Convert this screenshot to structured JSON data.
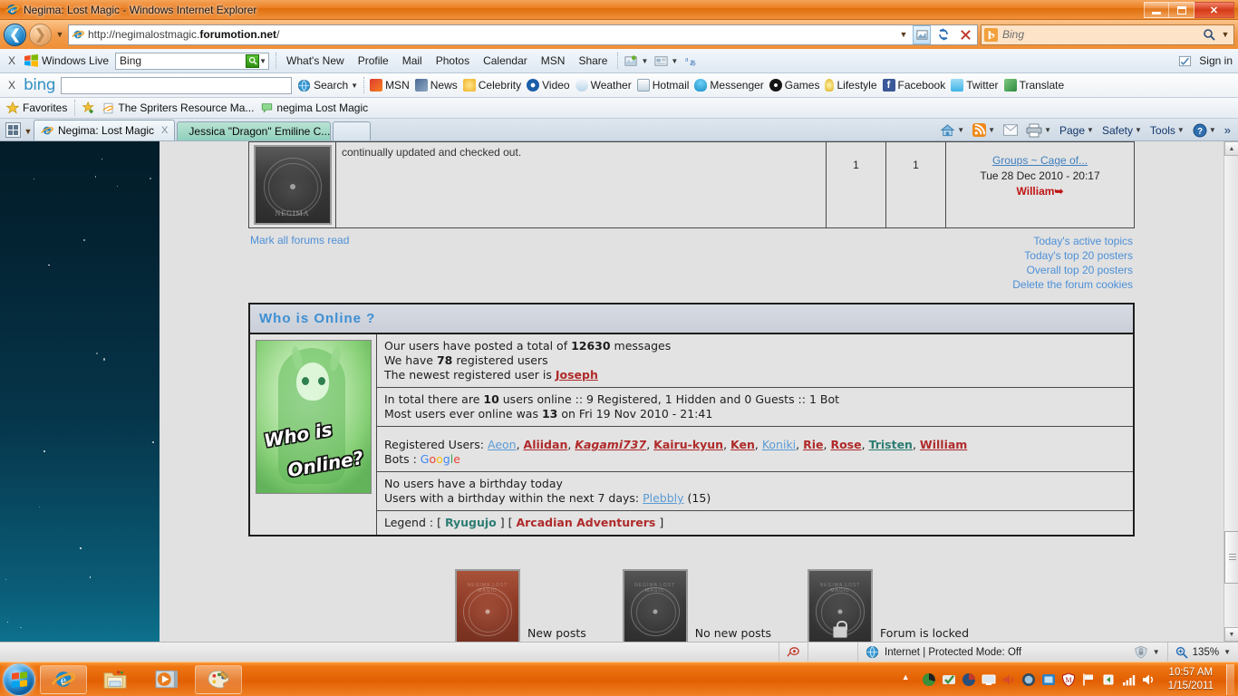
{
  "window": {
    "title": "Negima: Lost Magic - Windows Internet Explorer",
    "minimize_label": "Minimize",
    "maximize_label": "Restore",
    "close_label": "✕"
  },
  "address_bar": {
    "url_prefix": "http://negimalostmagic.",
    "url_bold": "forumotion.net",
    "url_suffix": "/",
    "search_placeholder": "Bing",
    "refresh_label": "↻",
    "stop_label": "✕"
  },
  "windows_live_bar": {
    "close_label": "X",
    "brand": "Windows Live",
    "search_value": "Bing",
    "links": [
      "What's New",
      "Profile",
      "Mail",
      "Photos",
      "Calendar",
      "MSN",
      "Share"
    ],
    "sign_in": "Sign in"
  },
  "bing_bar": {
    "close_label": "X",
    "brand": "bing",
    "search_value": "",
    "search_button": "Search",
    "links": [
      {
        "label": "MSN",
        "color": "#e03a2f"
      },
      {
        "label": "News",
        "color": "#3a5a8c"
      },
      {
        "label": "Celebrity",
        "color": "#f0c02a"
      },
      {
        "label": "Video",
        "color": "#1a5fa8"
      },
      {
        "label": "Weather",
        "color": "#8fbde0"
      },
      {
        "label": "Hotmail",
        "color": "#7c94a8"
      },
      {
        "label": "Messenger",
        "color": "#2aa5dd"
      },
      {
        "label": "Games",
        "color": "#1a1a1a"
      },
      {
        "label": "Lifestyle",
        "color": "#e8c53a"
      },
      {
        "label": "Facebook",
        "color": "#3b5998"
      },
      {
        "label": "Twitter",
        "color": "#3fb4e8"
      },
      {
        "label": "Translate",
        "color": "#3a9a4a"
      }
    ]
  },
  "favorites_bar": {
    "favorites_label": "Favorites",
    "items": [
      "The Spriters Resource  Ma...",
      "negima Lost Magic"
    ]
  },
  "tabs": {
    "active": "Negima: Lost Magic",
    "inactive": "Jessica \"Dragon\" Emiline C...",
    "close_label": "X",
    "commands": [
      "Page",
      "Safety",
      "Tools"
    ]
  },
  "forum_row": {
    "description": "continually updated and checked out.",
    "topics": "1",
    "posts": "1",
    "last_post_link": "Groups ~ Cage of...",
    "last_post_date": "Tue 28 Dec 2010 - 20:17",
    "last_post_author": "William",
    "card_label": "NEGIMA"
  },
  "forum_links": {
    "mark_read": "Mark all forums read",
    "right": [
      "Today's active topics",
      "Today's top 20 posters",
      "Overall top 20 posters",
      "Delete the forum cookies"
    ]
  },
  "who_is_online": {
    "heading": "Who is Online ?",
    "avatar_text_line1": "Who is",
    "avatar_text_line2": "Online?",
    "stats": {
      "posted_prefix": "Our users have posted a total of ",
      "total_messages": "12630",
      "posted_suffix": " messages",
      "registered_prefix": "We have ",
      "registered_count": "78",
      "registered_suffix": " registered users",
      "newest_prefix": "The newest registered user is ",
      "newest_user": "Joseph"
    },
    "online": {
      "total_prefix": "In total there are ",
      "total_count": "10",
      "total_suffix": " users online :: 9 Registered, 1 Hidden and 0 Guests :: 1 Bot",
      "most_prefix": "Most users ever online was ",
      "most_count": "13",
      "most_suffix": " on Fri 19 Nov 2010 - 21:41"
    },
    "registered_label": "Registered Users: ",
    "registered_users": [
      {
        "name": "Aeon",
        "style": "blue"
      },
      {
        "name": "Aliidan",
        "style": "red"
      },
      {
        "name": "Kagami737",
        "style": "red-italic"
      },
      {
        "name": "Kairu-kyun",
        "style": "red"
      },
      {
        "name": "Ken",
        "style": "red"
      },
      {
        "name": "Koniki",
        "style": "blue"
      },
      {
        "name": "Rie",
        "style": "red"
      },
      {
        "name": "Rose",
        "style": "red"
      },
      {
        "name": "Tristen",
        "style": "teal"
      },
      {
        "name": "William",
        "style": "red"
      }
    ],
    "bots_label": "Bots : ",
    "bot_name": "Google",
    "birthday_today": "No users have a birthday today",
    "birthday_week_prefix": "Users with a birthday within the next 7 days: ",
    "birthday_user": "Plebbly",
    "birthday_age": " (15)",
    "legend_label": "Legend : ",
    "legend_groups": [
      {
        "name": "Ryugujo",
        "color": "#2e7d73"
      },
      {
        "name": "Arcadian Adventurers",
        "color": "#b02a2a"
      }
    ]
  },
  "icon_legend": [
    {
      "label": "New posts",
      "state": "red"
    },
    {
      "label": "No new posts",
      "state": "gray"
    },
    {
      "label": "Forum is locked",
      "state": "locked"
    }
  ],
  "status_bar": {
    "zone": "Internet | Protected Mode: Off",
    "zoom": "135%"
  },
  "taskbar": {
    "start_label": "Start",
    "buttons": [
      "Internet Explorer",
      "Windows Explorer",
      "Windows Media Player",
      "Paint"
    ],
    "time": "10:57 AM",
    "date": "1/15/2011"
  }
}
